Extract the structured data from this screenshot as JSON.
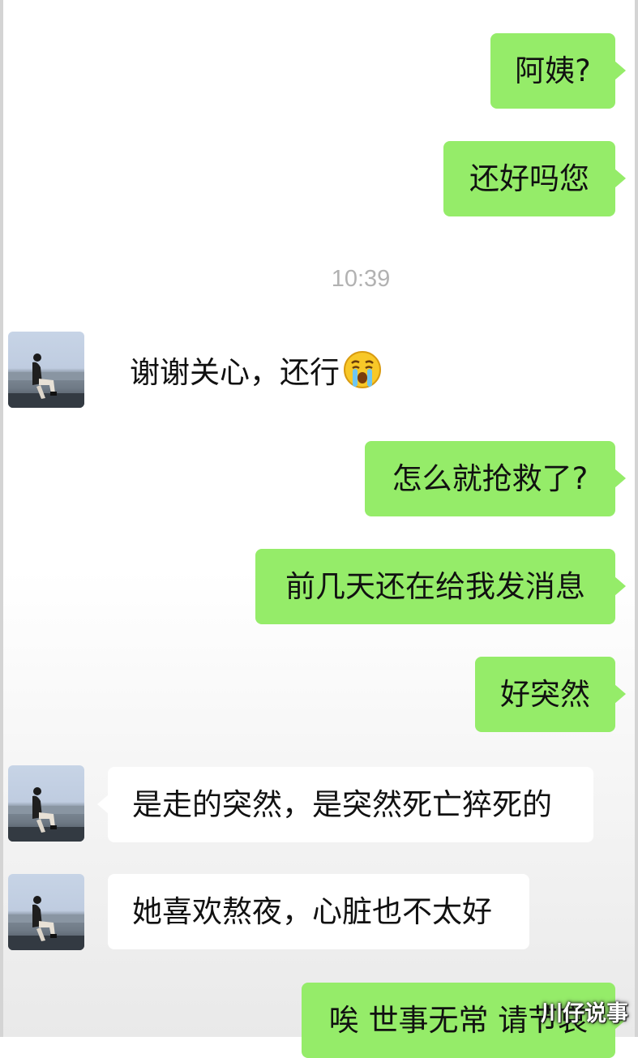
{
  "chat": {
    "timestamp": "10:39",
    "messages": [
      {
        "from": "me",
        "text": "阿姨?"
      },
      {
        "from": "me",
        "text": "还好吗您"
      },
      {
        "from": "contact",
        "text": "谢谢关心，还行",
        "emoji": "crying-face"
      },
      {
        "from": "me",
        "text": "怎么就抢救了?"
      },
      {
        "from": "me",
        "text": "前几天还在给我发消息"
      },
      {
        "from": "me",
        "text": "好突然"
      },
      {
        "from": "contact",
        "text": "是走的突然，是突然死亡猝死的"
      },
      {
        "from": "contact",
        "text": "她喜欢熬夜，心脏也不太好"
      },
      {
        "from": "me",
        "text": "唉 世事无常 请节哀"
      }
    ]
  },
  "watermark": "川仔说事",
  "colors": {
    "outgoing_bubble": "#95ec69",
    "incoming_bubble": "#ffffff",
    "timestamp_text": "#b2b2b2"
  },
  "icons": {
    "avatar": "contact-avatar-woman-sitting-by-sea",
    "emoji": "crying-face-emoji"
  }
}
